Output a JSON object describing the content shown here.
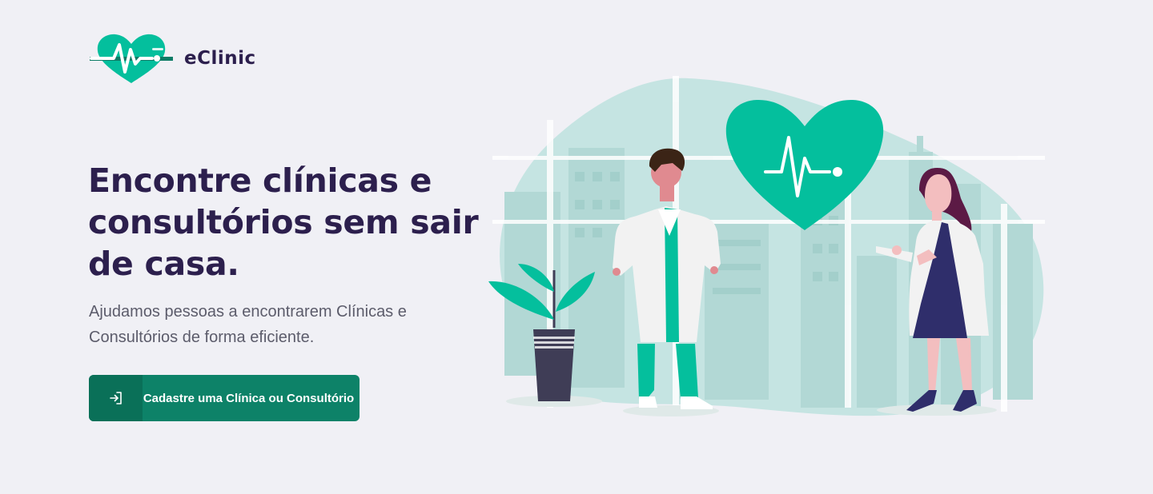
{
  "brand": {
    "name": "eClinic",
    "logo_icon": "heart-pulse-icon",
    "color_primary": "#04bf9d",
    "color_dark": "#2c1f4d"
  },
  "hero": {
    "title": "Encontre clínicas e consultórios sem sair de casa.",
    "subtitle": "Ajudamos pessoas a encontrarem Clínicas e Consultórios de forma eficiente."
  },
  "cta": {
    "label": "Cadastre uma Clínica ou Consultório",
    "icon": "sign-in-icon",
    "color": "#0d8268"
  },
  "illustration": {
    "subject": "doctors-illustration"
  }
}
